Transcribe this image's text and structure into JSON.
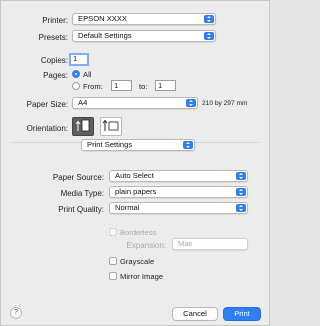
{
  "printer": {
    "label": "Printer:",
    "value": "EPSON XXXX"
  },
  "presets": {
    "label": "Presets:",
    "value": "Default Settings"
  },
  "copies": {
    "label": "Copies:",
    "value": "1"
  },
  "pages": {
    "label": "Pages:",
    "all_label": "All",
    "from_label": "From:",
    "from_value": "1",
    "to_label": "to:",
    "to_value": "1",
    "selected": "All"
  },
  "paper_size": {
    "label": "Paper Size:",
    "value": "A4",
    "dimensions": "210 by 297 mm"
  },
  "orientation": {
    "label": "Orientation:",
    "selected": "portrait"
  },
  "panel_menu": {
    "value": "Print Settings"
  },
  "paper_source": {
    "label": "Paper Source:",
    "value": "Auto Select"
  },
  "media_type": {
    "label": "Media Type:",
    "value": "plain papers"
  },
  "print_quality": {
    "label": "Print Quality:",
    "value": "Normal"
  },
  "borderless": {
    "label": "Borderless",
    "checked": false,
    "enabled": false
  },
  "expansion": {
    "label": "Expansion:",
    "value": "Max",
    "enabled": false
  },
  "grayscale": {
    "label": "Grayscale",
    "checked": false
  },
  "mirror_image": {
    "label": "Mirror Image",
    "checked": false
  },
  "footer": {
    "help": "?",
    "cancel": "Cancel",
    "print": "Print"
  },
  "colors": {
    "accent": "#2e7ff5",
    "background": "#ececec"
  },
  "icons": {
    "orientation_portrait": "portrait-orientation-icon",
    "orientation_landscape": "landscape-orientation-icon"
  }
}
